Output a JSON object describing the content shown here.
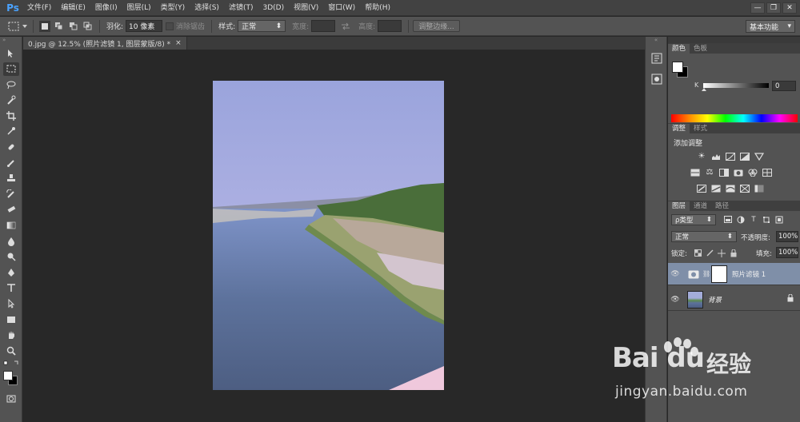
{
  "app": {
    "logo": "Ps"
  },
  "menu": [
    {
      "label": "文件(F)"
    },
    {
      "label": "编辑(E)"
    },
    {
      "label": "图像(I)"
    },
    {
      "label": "图层(L)"
    },
    {
      "label": "类型(Y)"
    },
    {
      "label": "选择(S)"
    },
    {
      "label": "滤镜(T)"
    },
    {
      "label": "3D(D)"
    },
    {
      "label": "视图(V)"
    },
    {
      "label": "窗口(W)"
    },
    {
      "label": "帮助(H)"
    }
  ],
  "window_controls": {
    "minimize": "—",
    "restore": "❐",
    "close": "✕"
  },
  "options": {
    "feather_label": "羽化:",
    "feather_value": "10 像素",
    "antialias_label": "消除锯齿",
    "style_label": "样式:",
    "style_value": "正常",
    "width_label": "宽度:",
    "height_label": "高度:",
    "refine_edge": "调整边缘...",
    "workspace": "基本功能"
  },
  "document": {
    "tab_title": "0.jpg @ 12.5% (照片滤镜 1, 图层蒙版/8) *",
    "close": "×"
  },
  "panels": {
    "color_tabs": [
      "颜色",
      "色板"
    ],
    "k_label": "K",
    "k_value": "0",
    "adjust_tabs": [
      "调整",
      "样式"
    ],
    "adjust_title": "添加调整",
    "layers_tabs": [
      "图层",
      "通道",
      "路径"
    ],
    "layer_filter": "ρ类型",
    "blend_mode": "正常",
    "opacity_label": "不透明度:",
    "opacity_value": "100%",
    "lock_label": "锁定:",
    "fill_label": "填充:",
    "fill_value": "100%",
    "layers": [
      {
        "name": "照片滤镜 1",
        "selected": true
      },
      {
        "name": "背景",
        "selected": false
      }
    ]
  },
  "colors": {
    "foreground": "#ffffff",
    "background": "#000000",
    "selection": "#7f8fa8"
  },
  "watermark": {
    "logo": "Bai du",
    "cn": "经验",
    "url": "jingyan.baidu.com"
  }
}
